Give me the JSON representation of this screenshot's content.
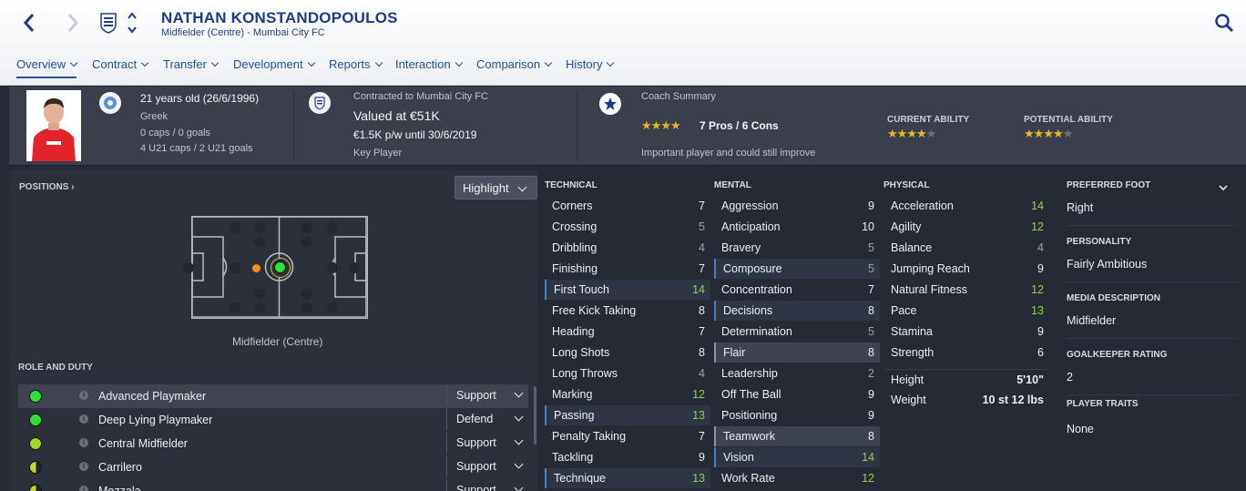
{
  "player": {
    "name": "NATHAN KONSTANDOPOULOS",
    "subtitle": "Midfielder (Centre) - Mumbai City FC"
  },
  "tabs": [
    {
      "label": "Overview",
      "active": true
    },
    {
      "label": "Contract"
    },
    {
      "label": "Transfer"
    },
    {
      "label": "Development"
    },
    {
      "label": "Reports"
    },
    {
      "label": "Interaction"
    },
    {
      "label": "Comparison"
    },
    {
      "label": "History"
    }
  ],
  "header": {
    "age": "21 years old (26/6/1996)",
    "nationality": "Greek",
    "caps": "0 caps / 0 goals",
    "u21": "4 U21 caps / 2 U21 goals",
    "contract_label": "Contracted to Mumbai City FC",
    "value": "Valued at €51K",
    "wage": "€1.5K p/w until 30/6/2019",
    "squad_status": "Key Player",
    "coach_title": "Coach Summary",
    "coach_stars": 4,
    "pros_cons": "7 Pros / 6 Cons",
    "coach_note": "Important player and could still improve",
    "current_ability_label": "CURRENT ABILITY",
    "current_ability_stars": 4,
    "potential_ability_label": "POTENTIAL ABILITY",
    "potential_ability_stars": 4
  },
  "positions": {
    "title": "POSITIONS",
    "highlight_label": "Highlight",
    "position_caption": "Midfielder (Centre)"
  },
  "roles": {
    "title": "ROLE AND DUTY",
    "items": [
      {
        "name": "Advanced Playmaker",
        "duty": "Support",
        "rating": "high",
        "selected": true
      },
      {
        "name": "Deep Lying Playmaker",
        "duty": "Defend",
        "rating": "high"
      },
      {
        "name": "Central Midfielder",
        "duty": "Support",
        "rating": "mid"
      },
      {
        "name": "Carrilero",
        "duty": "Support",
        "rating": "low"
      },
      {
        "name": "Mezzala",
        "duty": "Support",
        "rating": "low"
      }
    ]
  },
  "technical": {
    "title": "TECHNICAL",
    "items": [
      {
        "name": "Corners",
        "value": "7",
        "tone": "norm"
      },
      {
        "name": "Crossing",
        "value": "5",
        "tone": "dim"
      },
      {
        "name": "Dribbling",
        "value": "4",
        "tone": "dim"
      },
      {
        "name": "Finishing",
        "value": "7",
        "tone": "norm"
      },
      {
        "name": "First Touch",
        "value": "14",
        "tone": "green",
        "hl": "blue"
      },
      {
        "name": "Free Kick Taking",
        "value": "8",
        "tone": "norm"
      },
      {
        "name": "Heading",
        "value": "7",
        "tone": "norm"
      },
      {
        "name": "Long Shots",
        "value": "8",
        "tone": "norm"
      },
      {
        "name": "Long Throws",
        "value": "4",
        "tone": "dim"
      },
      {
        "name": "Marking",
        "value": "12",
        "tone": "green"
      },
      {
        "name": "Passing",
        "value": "13",
        "tone": "green",
        "hl": "blue"
      },
      {
        "name": "Penalty Taking",
        "value": "7",
        "tone": "norm"
      },
      {
        "name": "Tackling",
        "value": "9",
        "tone": "norm"
      },
      {
        "name": "Technique",
        "value": "13",
        "tone": "green",
        "hl": "blue"
      }
    ]
  },
  "mental": {
    "title": "MENTAL",
    "items": [
      {
        "name": "Aggression",
        "value": "9",
        "tone": "norm"
      },
      {
        "name": "Anticipation",
        "value": "10",
        "tone": "norm"
      },
      {
        "name": "Bravery",
        "value": "5",
        "tone": "dim"
      },
      {
        "name": "Composure",
        "value": "5",
        "tone": "dim",
        "hl": "blue"
      },
      {
        "name": "Concentration",
        "value": "7",
        "tone": "norm"
      },
      {
        "name": "Decisions",
        "value": "8",
        "tone": "norm",
        "hl": "blue"
      },
      {
        "name": "Determination",
        "value": "5",
        "tone": "dim"
      },
      {
        "name": "Flair",
        "value": "8",
        "tone": "norm",
        "hl": "grey"
      },
      {
        "name": "Leadership",
        "value": "2",
        "tone": "dim"
      },
      {
        "name": "Off The Ball",
        "value": "9",
        "tone": "norm"
      },
      {
        "name": "Positioning",
        "value": "9",
        "tone": "norm"
      },
      {
        "name": "Teamwork",
        "value": "8",
        "tone": "norm",
        "hl": "grey"
      },
      {
        "name": "Vision",
        "value": "14",
        "tone": "green",
        "hl": "blue"
      },
      {
        "name": "Work Rate",
        "value": "12",
        "tone": "green"
      }
    ]
  },
  "physical": {
    "title": "PHYSICAL",
    "items": [
      {
        "name": "Acceleration",
        "value": "14",
        "tone": "green"
      },
      {
        "name": "Agility",
        "value": "12",
        "tone": "green"
      },
      {
        "name": "Balance",
        "value": "4",
        "tone": "dim"
      },
      {
        "name": "Jumping Reach",
        "value": "9",
        "tone": "norm"
      },
      {
        "name": "Natural Fitness",
        "value": "12",
        "tone": "green"
      },
      {
        "name": "Pace",
        "value": "13",
        "tone": "green"
      },
      {
        "name": "Stamina",
        "value": "9",
        "tone": "norm"
      },
      {
        "name": "Strength",
        "value": "6",
        "tone": "norm"
      }
    ],
    "height_label": "Height",
    "height": "5'10\"",
    "weight_label": "Weight",
    "weight": "10 st 12 lbs"
  },
  "side": {
    "preferred_foot_label": "PREFERRED FOOT",
    "preferred_foot": "Right",
    "personality_label": "PERSONALITY",
    "personality": "Fairly Ambitious",
    "media_label": "MEDIA DESCRIPTION",
    "media": "Midfielder",
    "gk_label": "GOALKEEPER RATING",
    "gk": "2",
    "traits_label": "PLAYER TRAITS",
    "traits": "None"
  },
  "colors": {
    "accent": "#1f3a8a",
    "green_value": "#8fd14f",
    "star": "#e8b923",
    "role_high": "#2fe03a",
    "role_mid": "#a6d428",
    "role_low": "#c6d42a"
  }
}
